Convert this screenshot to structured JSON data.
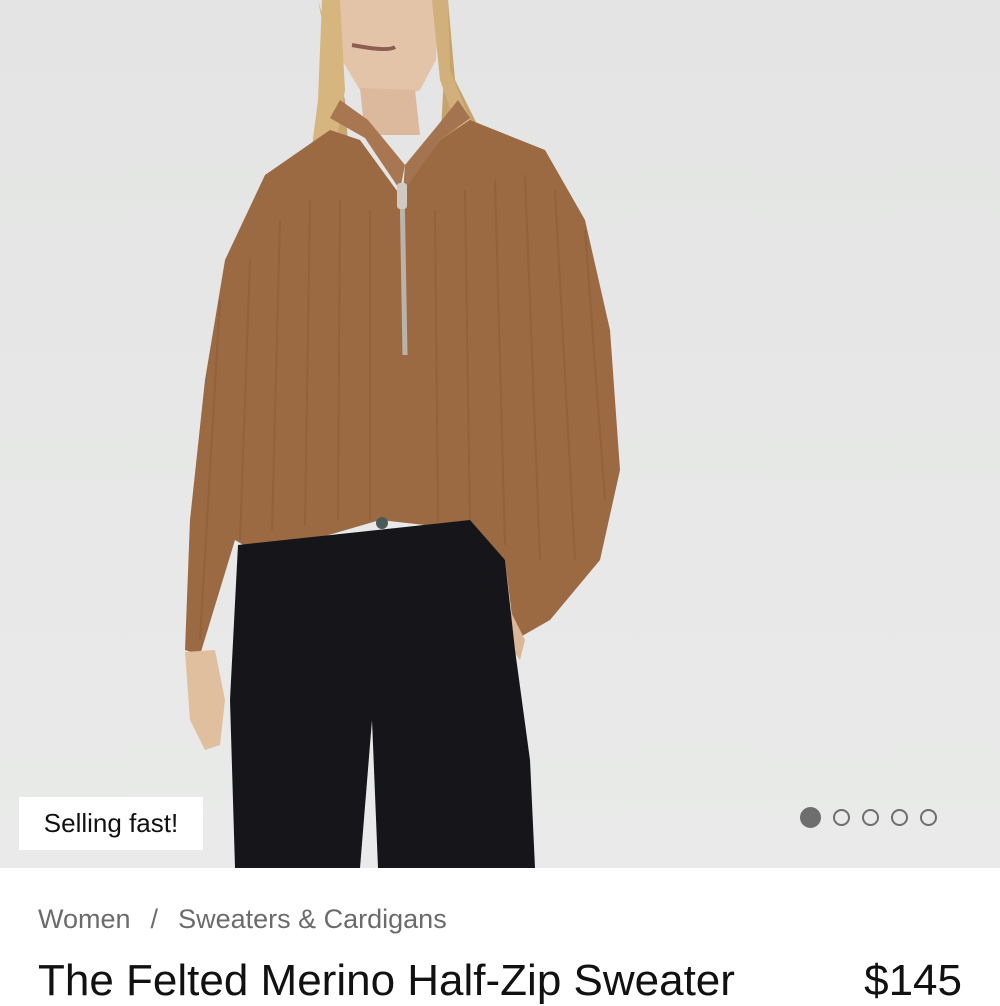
{
  "product": {
    "badge": "Selling fast!",
    "breadcrumb": [
      "Women",
      "Sweaters & Cardigans"
    ],
    "breadcrumb_separator": "/",
    "title": "The Felted Merino Half-Zip Sweater",
    "price": "$145"
  },
  "carousel": {
    "image_count": 5,
    "active_index": 0
  },
  "colors": {
    "sweater": "#9b6a43",
    "pants": "#16161a",
    "background": "#e5e6e5"
  }
}
